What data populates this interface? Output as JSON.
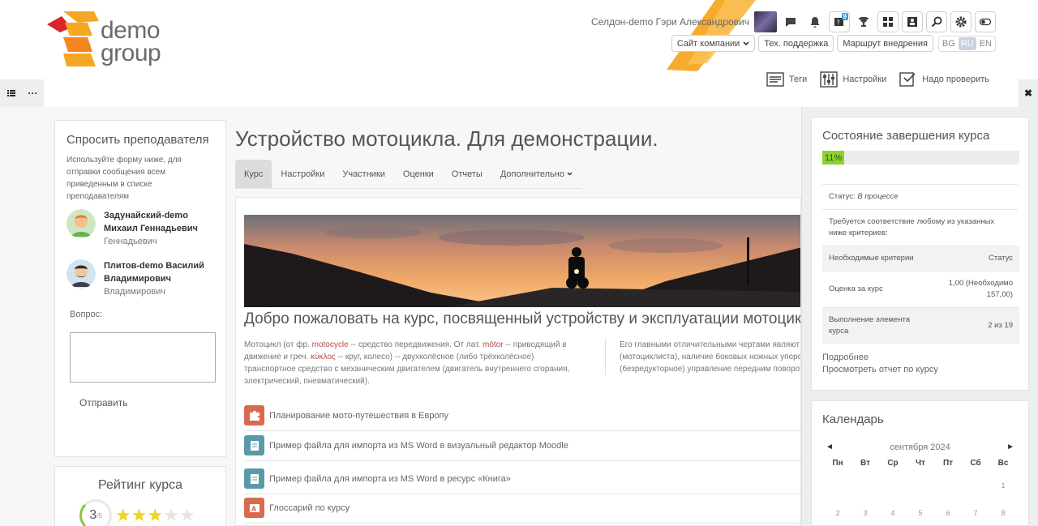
{
  "brand": {
    "line1": "demo",
    "line2": "group"
  },
  "header": {
    "user_name": "Селдон-demo Гэри Александрович",
    "badge_count": "9",
    "links": {
      "company_site": "Сайт компании",
      "support": "Тех. поддержка",
      "route": "Маршрут внедрения"
    },
    "languages": [
      "BG",
      "RU",
      "EN"
    ],
    "active_language": "RU",
    "tools": {
      "tags": "Теги",
      "settings": "Настройки",
      "review": "Надо проверить"
    }
  },
  "drawer": {
    "list_icon": "list-icon",
    "more_icon": "more-icon",
    "close_icon": "close-icon"
  },
  "ask": {
    "title": "Спросить преподавателя",
    "description": "Используйте форму ниже, для отправки сообщения всем приведенным в списке преподавателям",
    "teachers": [
      {
        "name": "Задунайский-demo Михаил Геннадьевич",
        "sub": "Геннадьевич"
      },
      {
        "name": "Плитов-demo Василий Владимирович",
        "sub": "Владимирович"
      }
    ],
    "question_label": "Вопрос:",
    "send_label": "Отправить"
  },
  "rating": {
    "title": "Рейтинг курса",
    "value": "3",
    "max_label": "/5",
    "stars_on": 3,
    "stars_total": 5
  },
  "course": {
    "title": "Устройство мотоцикла. Для демонстрации.",
    "tabs": [
      "Курс",
      "Настройки",
      "Участники",
      "Оценки",
      "Отчеты",
      "Дополнительно"
    ],
    "welcome": "Добро пожаловать на курс, посвященный устройству и эксплуатации мотоцик",
    "desc_left": {
      "p1": "Мотоцикл (от фр. ",
      "w1": "motocycle",
      "p2": " -- средство передвижения. От лат. ",
      "w2": "mōtor",
      "p3": " -- приводящий в движение и греч. ",
      "w3": "κύκλος",
      "p4": " -- круг, колесо) -- двухколёсное (либо трёхколёсное) транспортное средство с механическим двигателем (двигатель внутреннего сгорания, электрический, пневматический)."
    },
    "desc_right": {
      "l1": "Его главными отличительными чертами являют",
      "l2": "(мотоциклиста), наличие боковых ножных упоров",
      "l3": "(безредукторное) управление передним поворот"
    },
    "activities": [
      {
        "label": "Планирование мото-путешествия в Европу",
        "icon": "puzzle-icon",
        "color": "#d9694f"
      },
      {
        "label": "Пример файла для импорта из MS Word в визуальный редактор Moodle",
        "icon": "document-icon",
        "color": "#5a9aa8"
      },
      {
        "label": "Пример файла для импорта из MS Word в ресурс «Книга»",
        "icon": "document-icon",
        "color": "#5a9aa8"
      },
      {
        "label": "Глоссарий по курсу",
        "icon": "glossary-icon",
        "color": "#d9694f"
      }
    ]
  },
  "completion": {
    "title": "Состояние завершения курса",
    "progress_percent": 11,
    "progress_label": "11%",
    "status_label": "Статус:",
    "status_value": "В процессе",
    "requirement": "Требуется соответствие любому из указанных ниже критериев:",
    "header_criteria": "Необходимые критерии",
    "header_status": "Статус",
    "rows": [
      {
        "criteria": "Оценка за курс",
        "status": "1,00 (Необходимо 157,00)"
      },
      {
        "criteria": "Выполнение элемента курса",
        "status": "2 из 19"
      }
    ],
    "link_more": "Подробнее",
    "link_report": "Просмотреть отчет по курсу"
  },
  "calendar": {
    "title": "Календарь",
    "prev": "◄",
    "next": "►",
    "month": "сентября 2024",
    "weekdays": [
      "Пн",
      "Вт",
      "Ср",
      "Чт",
      "Пт",
      "Сб",
      "Вс"
    ],
    "week1": [
      "",
      "",
      "",
      "",
      "",
      "",
      "1"
    ],
    "week2": [
      "2",
      "3",
      "4",
      "5",
      "6",
      "7",
      "8"
    ]
  }
}
